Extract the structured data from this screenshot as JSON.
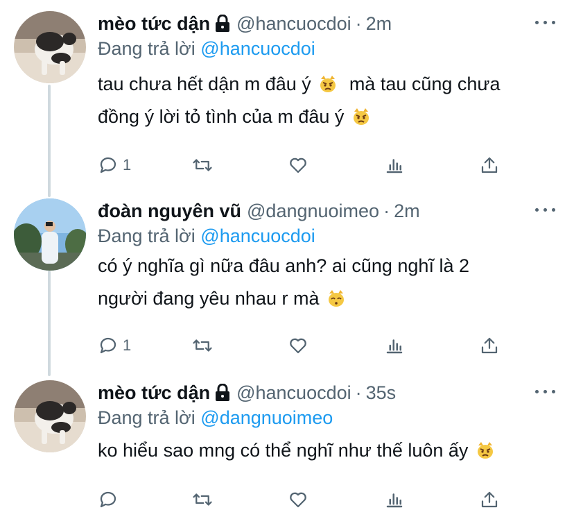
{
  "tweets": [
    {
      "name": "mèo tức dận",
      "locked": true,
      "handle": "@hancuocdoi",
      "dot": "·",
      "time": "2m",
      "replying_prefix": "Đang trả lời",
      "replying_to": "@hancuocdoi",
      "line1": "tau chưa hết dận m đâu ý",
      "line2": "mà tau cũng chưa",
      "line3": "đồng ý lời tỏ tình của m đâu ý",
      "reply_count": "1",
      "emoji": "angry-cat-emoji"
    },
    {
      "name": "đoàn nguyên vũ",
      "locked": false,
      "handle": "@dangnuoimeo",
      "dot": "·",
      "time": "2m",
      "replying_prefix": "Đang trả lời",
      "replying_to": "@hancuocdoi",
      "line1": "có ý nghĩa gì nữa đâu anh? ai cũng nghĩ là 2",
      "line2": "người đang yêu nhau r mà",
      "reply_count": "1",
      "emoji": "kissing-cat-emoji"
    },
    {
      "name": "mèo tức dận",
      "locked": true,
      "handle": "@hancuocdoi",
      "dot": "·",
      "time": "35s",
      "replying_prefix": "Đang trả lời",
      "replying_to": "@dangnuoimeo",
      "line1": "ko hiểu sao mng có thể nghĩ như thế luôn ấy",
      "reply_count": "",
      "emoji": "angry-cat-emoji"
    }
  ],
  "colors": {
    "text": "#0f1419",
    "secondary": "#536471",
    "accent": "#1d9bf0",
    "thread_line": "#cfd9de"
  },
  "icons": [
    "reply-icon",
    "retweet-icon",
    "like-icon",
    "views-icon",
    "share-icon",
    "more-icon",
    "lock-icon"
  ]
}
